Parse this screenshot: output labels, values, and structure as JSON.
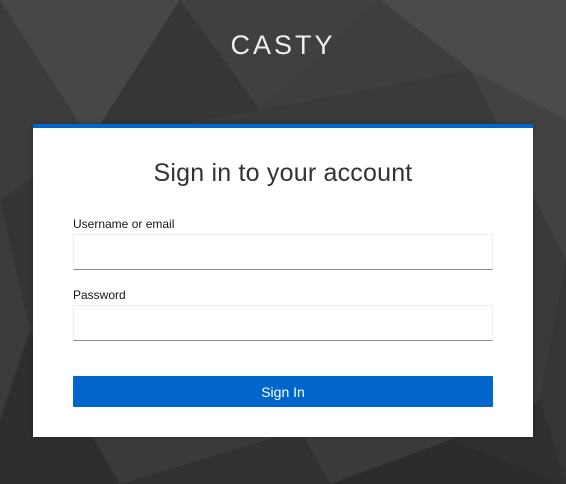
{
  "brand": {
    "name": "CASTY"
  },
  "login": {
    "title": "Sign in to your account",
    "username": {
      "label": "Username or email",
      "value": "",
      "placeholder": ""
    },
    "password": {
      "label": "Password",
      "value": "",
      "placeholder": ""
    },
    "submit_label": "Sign In"
  },
  "colors": {
    "accent": "#0066cc",
    "background": "#3a3a3a",
    "card": "#ffffff"
  }
}
